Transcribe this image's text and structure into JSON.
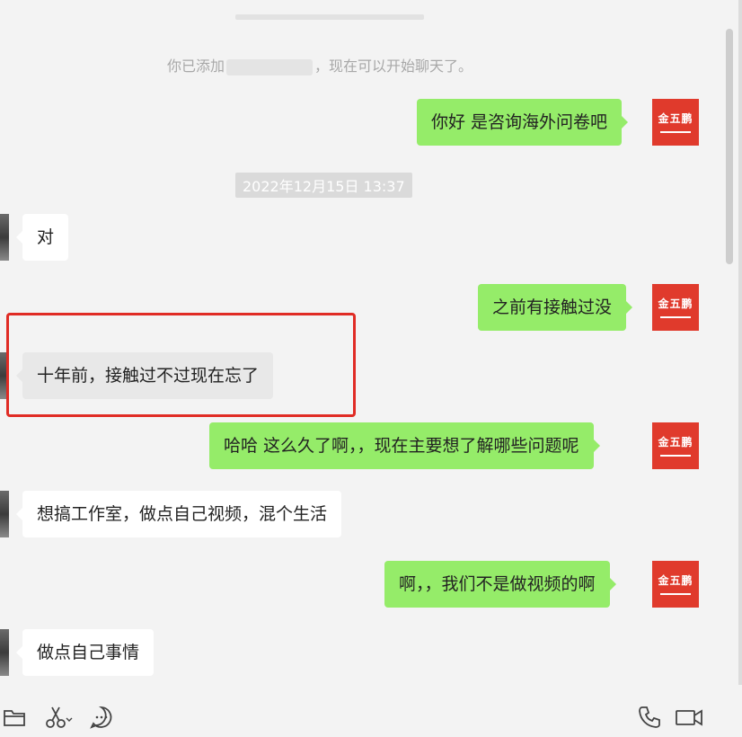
{
  "system_note": {
    "prefix": "你已添加",
    "suffix": "，现在可以开始聊天了。"
  },
  "timestamp": "2022年12月15日 13:37",
  "self_avatar": {
    "label": "金五鹏",
    "color": "#e03a2c"
  },
  "messages": [
    {
      "side": "sent",
      "text": "你好 是咨询海外问卷吧"
    },
    {
      "side": "recv",
      "text": "对"
    },
    {
      "side": "sent",
      "text": "之前有接触过没"
    },
    {
      "side": "recv",
      "text": "十年前，接触过不过现在忘了",
      "highlighted": true
    },
    {
      "side": "sent",
      "text": "哈哈 这么久了啊，，现在主要想了解哪些问题呢"
    },
    {
      "side": "recv",
      "text": "想搞工作室，做点自己视频，混个生活"
    },
    {
      "side": "sent",
      "text": "啊，，我们不是做视频的啊"
    },
    {
      "side": "recv",
      "text": "做点自己事情"
    }
  ],
  "toolbar": {
    "left": [
      "folder-icon",
      "scissors-icon",
      "chat-bubble-icon"
    ],
    "right": [
      "phone-icon",
      "video-camera-icon"
    ]
  },
  "colors": {
    "sent_bubble": "#95ec69",
    "recv_bubble": "#ffffff",
    "highlight_border": "#e02b24",
    "background": "#f3f3f3"
  }
}
